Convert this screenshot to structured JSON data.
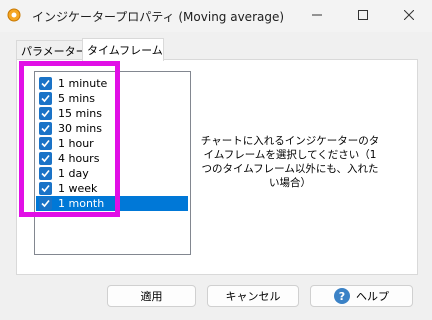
{
  "window": {
    "title": "インジケータープロパティ (Moving average)",
    "icons": {
      "app": "gear-icon",
      "minimize": "minimize-icon",
      "maximize": "maximize-icon",
      "close": "close-icon"
    }
  },
  "tabs": [
    {
      "label": "パラメーター",
      "active": false
    },
    {
      "label": "タイムフレーム",
      "active": true
    }
  ],
  "timeframes": [
    {
      "label": "1 minute",
      "checked": true,
      "selected": false
    },
    {
      "label": "5 mins",
      "checked": true,
      "selected": false
    },
    {
      "label": "15 mins",
      "checked": true,
      "selected": false
    },
    {
      "label": "30 mins",
      "checked": true,
      "selected": false
    },
    {
      "label": "1 hour",
      "checked": true,
      "selected": false
    },
    {
      "label": "4 hours",
      "checked": true,
      "selected": false
    },
    {
      "label": "1 day",
      "checked": true,
      "selected": false
    },
    {
      "label": "1 week",
      "checked": true,
      "selected": false
    },
    {
      "label": "1 month",
      "checked": true,
      "selected": true
    }
  ],
  "description": "チャートに入れるインジケーターのタイムフレームを選択してください（1つのタイムフレーム以外にも、入れたい場合）",
  "buttons": {
    "apply": "適用",
    "cancel": "キャンセル",
    "help": "ヘルプ"
  },
  "colors": {
    "accent": "#0078d7",
    "checkbox": "#1a73c7",
    "highlight": "#e10fe6"
  }
}
